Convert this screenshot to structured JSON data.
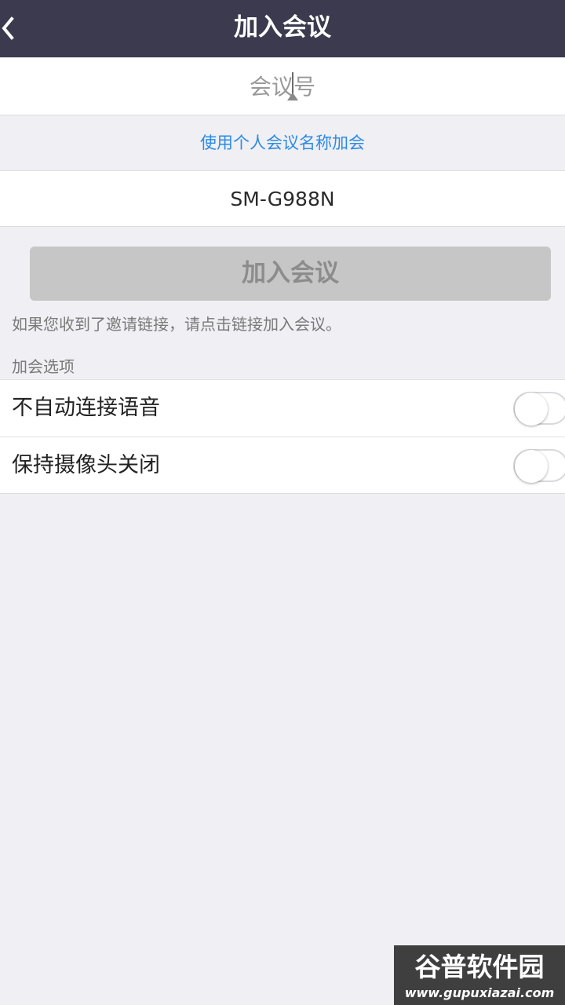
{
  "header": {
    "title": "加入会议",
    "back_icon": "chevron-left-icon"
  },
  "meeting_id": {
    "placeholder": "会议号",
    "value": ""
  },
  "personal_link": "使用个人会议名称加会",
  "display_name": {
    "value": "SM-G988N"
  },
  "join_button": "加入会议",
  "hint": "如果您收到了邀请链接，请点击链接加入会议。",
  "options_section": {
    "label": "加会选项",
    "items": [
      {
        "label": "不自动连接语音",
        "enabled": false
      },
      {
        "label": "保持摄像头关闭",
        "enabled": false
      }
    ]
  },
  "watermark": {
    "title": "谷普软件园",
    "url": "www.gupuxiazai.com"
  },
  "colors": {
    "header_bg": "#3b3a4e",
    "link": "#2d8be3",
    "button_disabled": "#c6c6c6",
    "background": "#efeff4"
  }
}
